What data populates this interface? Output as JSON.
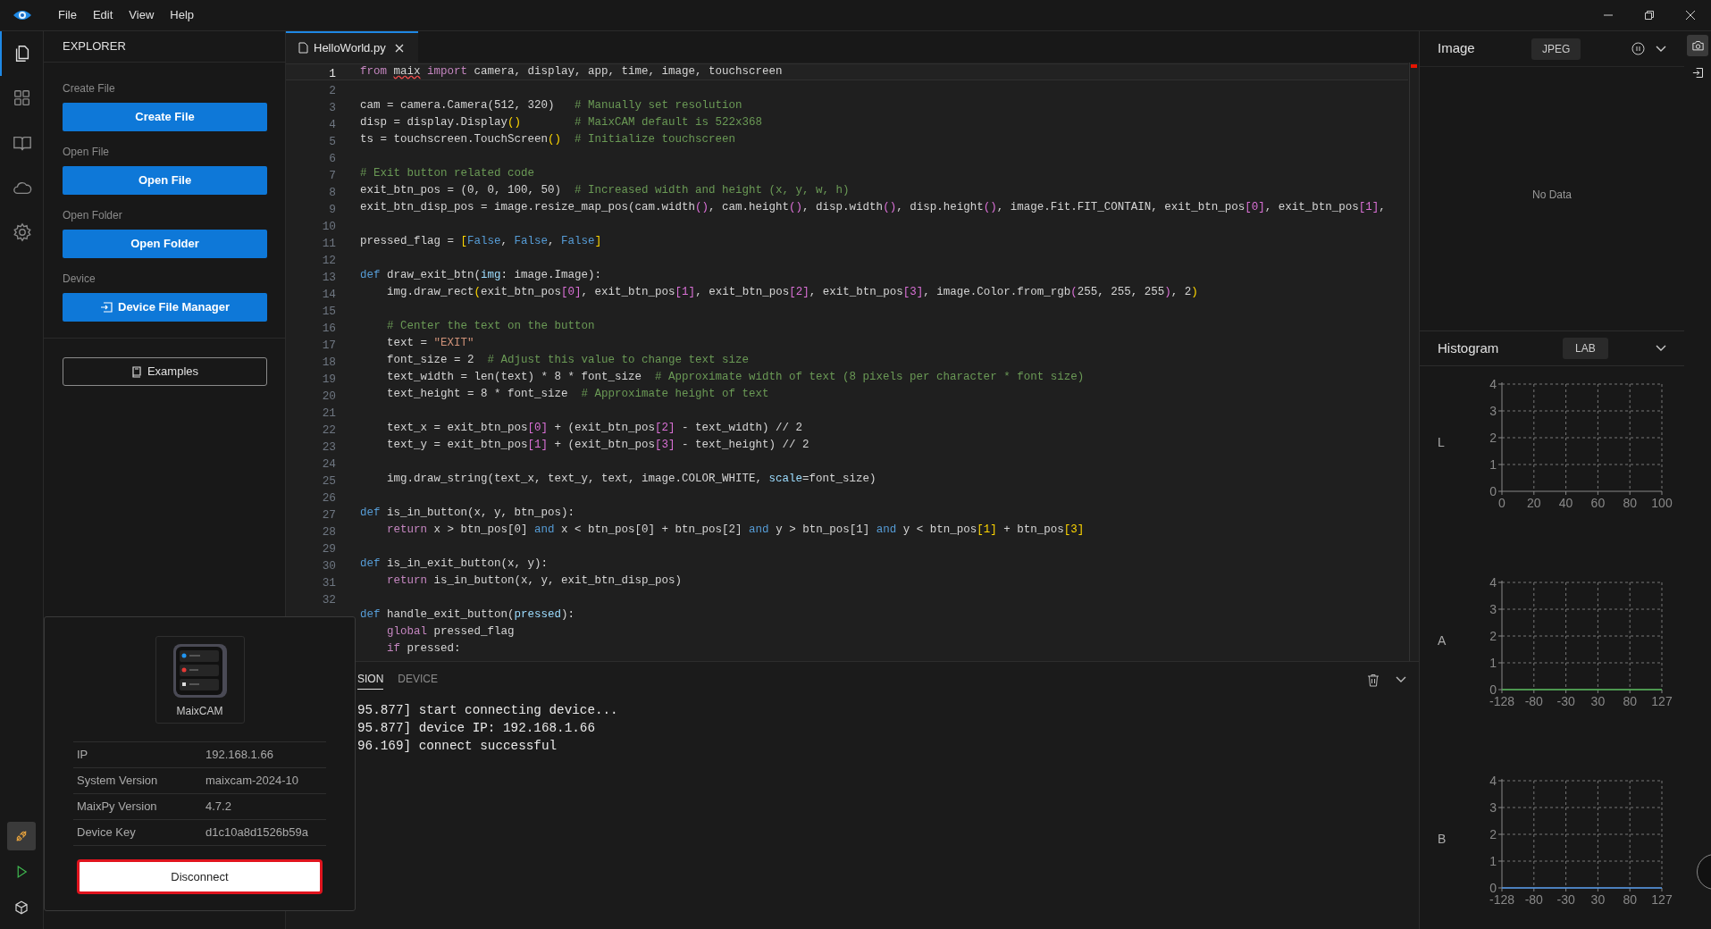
{
  "menu": [
    "File",
    "Edit",
    "View",
    "Help"
  ],
  "activity_bar": {
    "top": [
      {
        "kind": "files",
        "selected": true
      },
      {
        "kind": "extensions",
        "selected": false
      },
      {
        "kind": "book",
        "selected": false
      },
      {
        "kind": "cloud",
        "selected": false
      },
      {
        "kind": "settings",
        "selected": false
      }
    ],
    "bottom": [
      {
        "kind": "connection",
        "selected": true
      },
      {
        "kind": "run",
        "selected": false
      },
      {
        "kind": "package",
        "selected": false
      }
    ]
  },
  "explorer": {
    "title": "EXPLORER",
    "sections": [
      {
        "kind": "plain",
        "label": "Create File",
        "button": "Create File"
      },
      {
        "kind": "plain",
        "label": "Open File",
        "button": "Open File"
      },
      {
        "kind": "plain",
        "label": "Open Folder",
        "button": "Open Folder"
      },
      {
        "kind": "with_icon",
        "label": "Device",
        "button": "Device File Manager"
      }
    ],
    "examples": "Examples"
  },
  "editor": {
    "tabs": [
      {
        "label": "HelloWorld.py",
        "selected": true
      }
    ],
    "lines": [
      {
        "number": "1",
        "current": true,
        "tokens": [
          {
            "kind": "keyword",
            "text": "from "
          },
          {
            "kind": "error",
            "text": "maix"
          },
          {
            "kind": "keyword",
            "text": " import"
          },
          {
            "kind": "plain",
            "text": " camera, display, app, time, image, touchscreen"
          }
        ]
      },
      {
        "number": "2",
        "current": false
      },
      {
        "number": "3",
        "current": false,
        "tokens": [
          {
            "kind": "plain",
            "text": "cam = camera.Camera(512, 320)"
          },
          {
            "kind": "comment",
            "text": "   # Manually set resolution"
          }
        ]
      },
      {
        "number": "4",
        "current": false,
        "tokens": [
          {
            "kind": "plain",
            "text": "disp = display.Display"
          },
          {
            "kind": "bracket",
            "text": "()"
          },
          {
            "kind": "comment",
            "text": "        # MaixCAM default is 522x368"
          }
        ]
      },
      {
        "number": "5",
        "current": false,
        "tokens": [
          {
            "kind": "plain",
            "text": "ts = touchscreen.TouchScreen"
          },
          {
            "kind": "bracket",
            "text": "()"
          },
          {
            "kind": "comment",
            "text": "  # Initialize touchscreen"
          }
        ]
      },
      {
        "number": "6",
        "current": false
      },
      {
        "number": "7",
        "current": false,
        "tokens": [
          {
            "kind": "comment",
            "text": "# Exit button related code"
          }
        ]
      },
      {
        "number": "8",
        "current": false,
        "tokens": [
          {
            "kind": "plain",
            "text": "exit_btn_pos = (0, 0, 100, 50)"
          },
          {
            "kind": "comment",
            "text": "  # Increased width and height (x, y, w, h)"
          }
        ]
      },
      {
        "number": "9",
        "current": false,
        "tokens": [
          {
            "kind": "plain",
            "text": "exit_btn_disp_pos = image.resize_map_pos(cam.width"
          },
          {
            "kind": "bracket2",
            "text": "()"
          },
          {
            "kind": "plain",
            "text": ", cam.height"
          },
          {
            "kind": "bracket2",
            "text": "()"
          },
          {
            "kind": "plain",
            "text": ", disp.width"
          },
          {
            "kind": "bracket2",
            "text": "()"
          },
          {
            "kind": "plain",
            "text": ", disp.height"
          },
          {
            "kind": "bracket2",
            "text": "()"
          },
          {
            "kind": "plain",
            "text": ", image.Fit.FIT_CONTAIN, exit_btn_pos"
          },
          {
            "kind": "bracket2",
            "text": "[0]"
          },
          {
            "kind": "plain",
            "text": ", exit_btn_pos"
          },
          {
            "kind": "bracket2",
            "text": "[1]"
          },
          {
            "kind": "plain",
            "text": ","
          }
        ]
      },
      {
        "number": "10",
        "current": false
      },
      {
        "number": "11",
        "current": false,
        "tokens": [
          {
            "kind": "plain",
            "text": "pressed_flag = "
          },
          {
            "kind": "bracket",
            "text": "["
          },
          {
            "kind": "constant",
            "text": "False"
          },
          {
            "kind": "plain",
            "text": ", "
          },
          {
            "kind": "constant",
            "text": "False"
          },
          {
            "kind": "plain",
            "text": ", "
          },
          {
            "kind": "constant",
            "text": "False"
          },
          {
            "kind": "bracket",
            "text": "]"
          }
        ]
      },
      {
        "number": "12",
        "current": false
      },
      {
        "number": "13",
        "current": false,
        "tokens": [
          {
            "kind": "constant",
            "text": "def"
          },
          {
            "kind": "plain",
            "text": " draw_exit_btn("
          },
          {
            "kind": "param",
            "text": "img"
          },
          {
            "kind": "plain",
            "text": ": image.Image):"
          }
        ]
      },
      {
        "number": "14",
        "current": false,
        "tokens": [
          {
            "kind": "plain",
            "text": "    img.draw_rect"
          },
          {
            "kind": "bracket",
            "text": "("
          },
          {
            "kind": "plain",
            "text": "exit_btn_pos"
          },
          {
            "kind": "bracket2",
            "text": "[0]"
          },
          {
            "kind": "plain",
            "text": ", exit_btn_pos"
          },
          {
            "kind": "bracket2",
            "text": "[1]"
          },
          {
            "kind": "plain",
            "text": ", exit_btn_pos"
          },
          {
            "kind": "bracket2",
            "text": "[2]"
          },
          {
            "kind": "plain",
            "text": ", exit_btn_pos"
          },
          {
            "kind": "bracket2",
            "text": "[3]"
          },
          {
            "kind": "plain",
            "text": ", image.Color.from_rgb"
          },
          {
            "kind": "bracket2",
            "text": "("
          },
          {
            "kind": "plain",
            "text": "255, 255, 255"
          },
          {
            "kind": "bracket2",
            "text": ")"
          },
          {
            "kind": "plain",
            "text": ", 2"
          },
          {
            "kind": "bracket",
            "text": ")"
          }
        ]
      },
      {
        "number": "15",
        "current": false
      },
      {
        "number": "16",
        "current": false,
        "tokens": [
          {
            "kind": "comment",
            "text": "    # Center the text on the button"
          }
        ]
      },
      {
        "number": "17",
        "current": false,
        "tokens": [
          {
            "kind": "plain",
            "text": "    text = "
          },
          {
            "kind": "string",
            "text": "\"EXIT\""
          }
        ]
      },
      {
        "number": "18",
        "current": false,
        "tokens": [
          {
            "kind": "plain",
            "text": "    font_size = 2"
          },
          {
            "kind": "comment",
            "text": "  # Adjust this value to change text size"
          }
        ]
      },
      {
        "number": "19",
        "current": false,
        "tokens": [
          {
            "kind": "plain",
            "text": "    text_width = len(text) * 8 * font_size"
          },
          {
            "kind": "comment",
            "text": "  # Approximate width of text (8 pixels per character * font size)"
          }
        ]
      },
      {
        "number": "20",
        "current": false,
        "tokens": [
          {
            "kind": "plain",
            "text": "    text_height = 8 * font_size"
          },
          {
            "kind": "comment",
            "text": "  # Approximate height of text"
          }
        ]
      },
      {
        "number": "21",
        "current": false
      },
      {
        "number": "22",
        "current": false,
        "tokens": [
          {
            "kind": "plain",
            "text": "    text_x = exit_btn_pos"
          },
          {
            "kind": "bracket2",
            "text": "[0]"
          },
          {
            "kind": "plain",
            "text": " + (exit_btn_pos"
          },
          {
            "kind": "bracket2",
            "text": "[2]"
          },
          {
            "kind": "plain",
            "text": " - text_width) // 2"
          }
        ]
      },
      {
        "number": "23",
        "current": false,
        "tokens": [
          {
            "kind": "plain",
            "text": "    text_y = exit_btn_pos"
          },
          {
            "kind": "bracket2",
            "text": "[1]"
          },
          {
            "kind": "plain",
            "text": " + (exit_btn_pos"
          },
          {
            "kind": "bracket2",
            "text": "[3]"
          },
          {
            "kind": "plain",
            "text": " - text_height) // 2"
          }
        ]
      },
      {
        "number": "24",
        "current": false
      },
      {
        "number": "25",
        "current": false,
        "tokens": [
          {
            "kind": "plain",
            "text": "    img.draw_string(text_x, text_y, text, image.COLOR_WHITE, "
          },
          {
            "kind": "param",
            "text": "scale"
          },
          {
            "kind": "plain",
            "text": "=font_size)"
          }
        ]
      },
      {
        "number": "26",
        "current": false
      },
      {
        "number": "27",
        "current": false,
        "tokens": [
          {
            "kind": "constant",
            "text": "def"
          },
          {
            "kind": "plain",
            "text": " is_in_button(x, y, btn_pos):"
          }
        ]
      },
      {
        "number": "28",
        "current": false,
        "tokens": [
          {
            "kind": "keyword",
            "text": "    return"
          },
          {
            "kind": "plain",
            "text": " x > btn_pos[0] "
          },
          {
            "kind": "constant",
            "text": "and"
          },
          {
            "kind": "plain",
            "text": " x < btn_pos[0] + btn_pos[2] "
          },
          {
            "kind": "constant",
            "text": "and"
          },
          {
            "kind": "plain",
            "text": " y > btn_pos[1] "
          },
          {
            "kind": "constant",
            "text": "and"
          },
          {
            "kind": "plain",
            "text": " y < btn_pos"
          },
          {
            "kind": "bracket",
            "text": "[1]"
          },
          {
            "kind": "plain",
            "text": " + btn_pos"
          },
          {
            "kind": "bracket",
            "text": "[3]"
          }
        ]
      },
      {
        "number": "29",
        "current": false
      },
      {
        "number": "30",
        "current": false,
        "tokens": [
          {
            "kind": "constant",
            "text": "def"
          },
          {
            "kind": "plain",
            "text": " is_in_exit_button(x, y):"
          }
        ]
      },
      {
        "number": "31",
        "current": false,
        "tokens": [
          {
            "kind": "keyword",
            "text": "    return"
          },
          {
            "kind": "plain",
            "text": " is_in_button(x, y, exit_btn_disp_pos)"
          }
        ]
      },
      {
        "number": "32",
        "current": false
      },
      {
        "current": false,
        "tokens": [
          {
            "kind": "constant",
            "text": "def"
          },
          {
            "kind": "plain",
            "text": " handle_exit_button("
          },
          {
            "kind": "param",
            "text": "pressed"
          },
          {
            "kind": "plain",
            "text": "):"
          }
        ]
      },
      {
        "current": false,
        "tokens": [
          {
            "kind": "keyword",
            "text": "    global"
          },
          {
            "kind": "plain",
            "text": " pressed_flag"
          }
        ]
      },
      {
        "current": false,
        "tokens": [
          {
            "kind": "keyword",
            "text": "    if"
          },
          {
            "kind": "plain",
            "text": " pressed:"
          }
        ]
      }
    ]
  },
  "terminal": {
    "tabs": [
      {
        "label": "SION",
        "selected": true
      },
      {
        "label": "DEVICE",
        "selected": false
      }
    ],
    "lines": [
      "95.877] start connecting device...",
      "95.877] device IP: 192.168.1.66",
      "96.169] connect successful"
    ]
  },
  "image_panel": {
    "title": "Image",
    "format": "JPEG",
    "message": "No Data"
  },
  "histogram": {
    "title": "Histogram",
    "mode": "LAB",
    "charts": [
      {
        "label": "L",
        "chart_data": {
          "type": "line",
          "grid": true,
          "categories": [
            "0",
            "20",
            "40",
            "60",
            "80",
            "100"
          ],
          "ylim": [
            0,
            4
          ],
          "yticks": [
            0,
            1,
            2,
            3,
            4
          ]
        }
      },
      {
        "label": "A",
        "chart_data": {
          "type": "line",
          "grid": true,
          "categories": [
            "-128",
            "-80",
            "-30",
            "30",
            "80",
            "127"
          ],
          "ylim": [
            0,
            4
          ],
          "yticks": [
            0,
            1,
            2,
            3,
            4
          ],
          "series": [
            {
              "color": "#4caf50",
              "values": [
                0,
                0,
                0,
                0,
                0,
                0
              ]
            }
          ]
        }
      },
      {
        "label": "B",
        "chart_data": {
          "type": "line",
          "grid": true,
          "categories": [
            "-128",
            "-80",
            "-30",
            "30",
            "80",
            "127"
          ],
          "ylim": [
            0,
            4
          ],
          "yticks": [
            0,
            1,
            2,
            3,
            4
          ],
          "series": [
            {
              "color": "#4a90e2",
              "values": [
                0,
                0,
                0,
                0,
                0,
                0
              ]
            }
          ]
        }
      }
    ]
  },
  "right_bar": [
    {
      "kind": "camera",
      "selected": true
    },
    {
      "kind": "import",
      "selected": false
    }
  ],
  "device_popup": {
    "device_name": "MaixCAM",
    "info": [
      {
        "label": "IP",
        "value": "192.168.1.66"
      },
      {
        "label": "System Version",
        "value": "maixcam-2024-10"
      },
      {
        "label": "MaixPy Version",
        "value": "4.7.2"
      },
      {
        "label": "Device Key",
        "value": "d1c10a8d1526b59a"
      }
    ],
    "button": "Disconnect"
  }
}
